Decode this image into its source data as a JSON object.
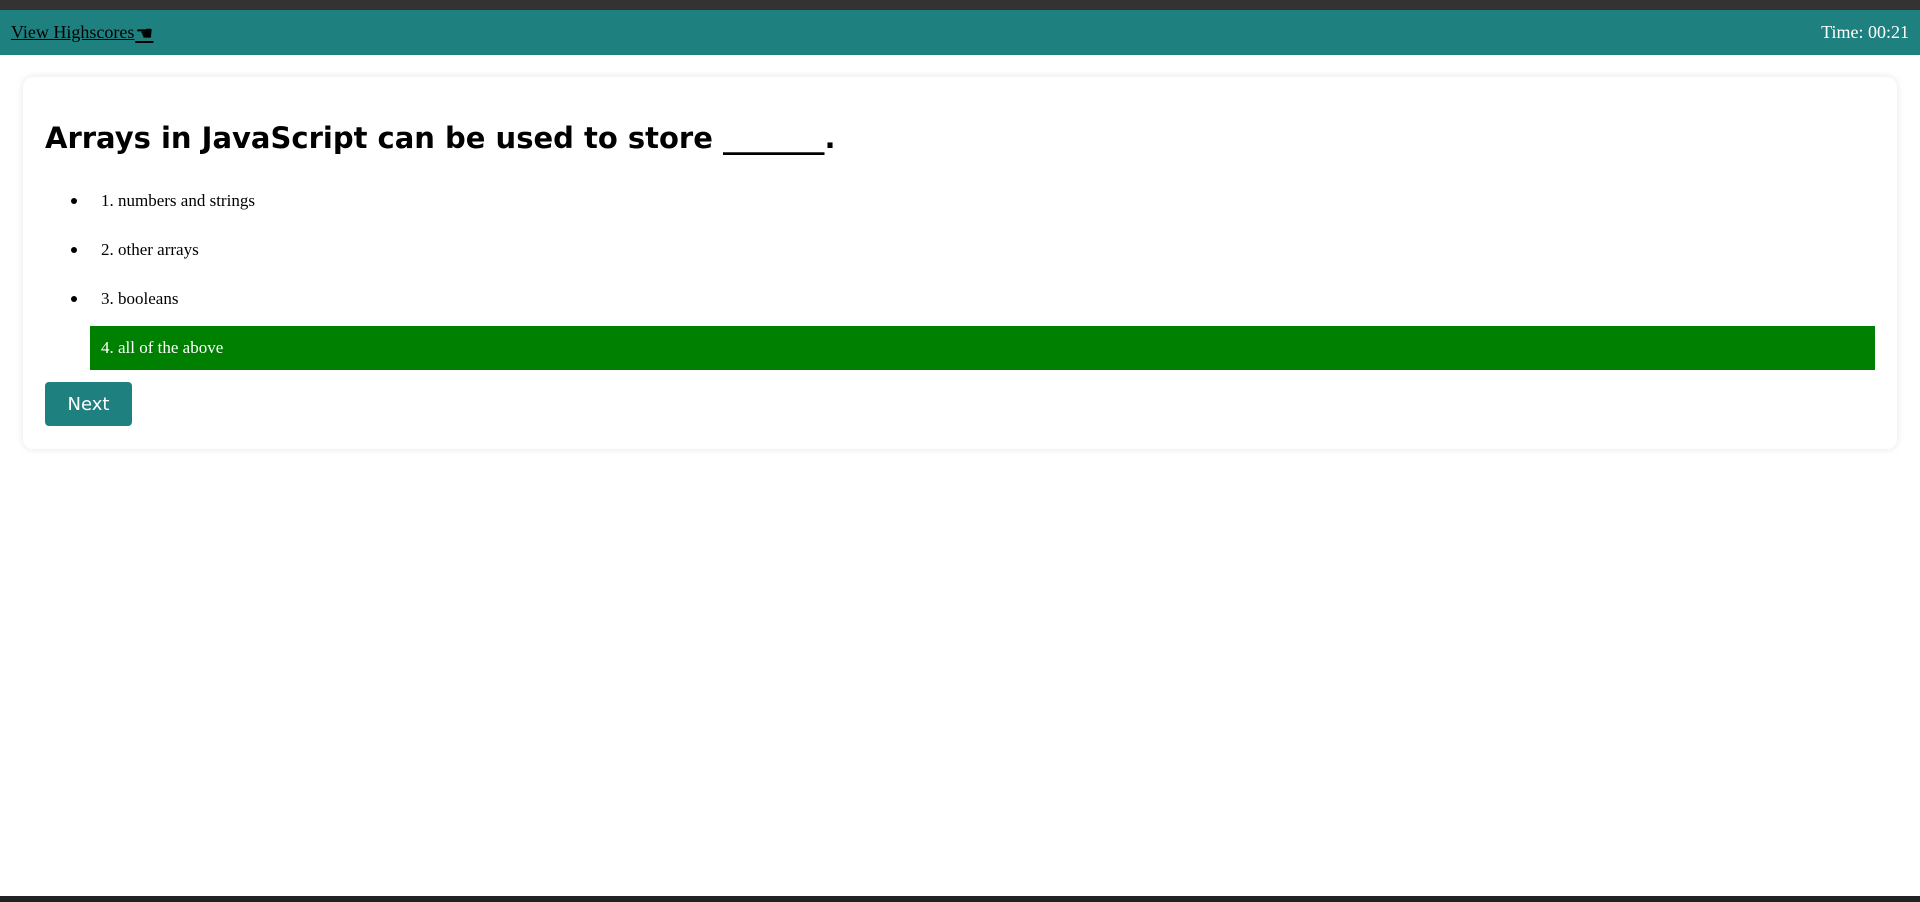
{
  "header": {
    "highscores_label": "View Highscores",
    "pointer_icon": "hand-pointing-icon",
    "timer_text": "Time: 00:21"
  },
  "quiz": {
    "question": "Arrays in JavaScript can be used to store _______.",
    "choices": [
      {
        "label": "1. numbers and strings",
        "selected": false
      },
      {
        "label": "2. other arrays",
        "selected": false
      },
      {
        "label": "3. booleans",
        "selected": false
      },
      {
        "label": "4. all of the above",
        "selected": true
      }
    ],
    "next_label": "Next"
  },
  "colors": {
    "header_bg": "#1f8080",
    "selected_choice_bg": "#008000",
    "button_bg": "#1f8080"
  }
}
